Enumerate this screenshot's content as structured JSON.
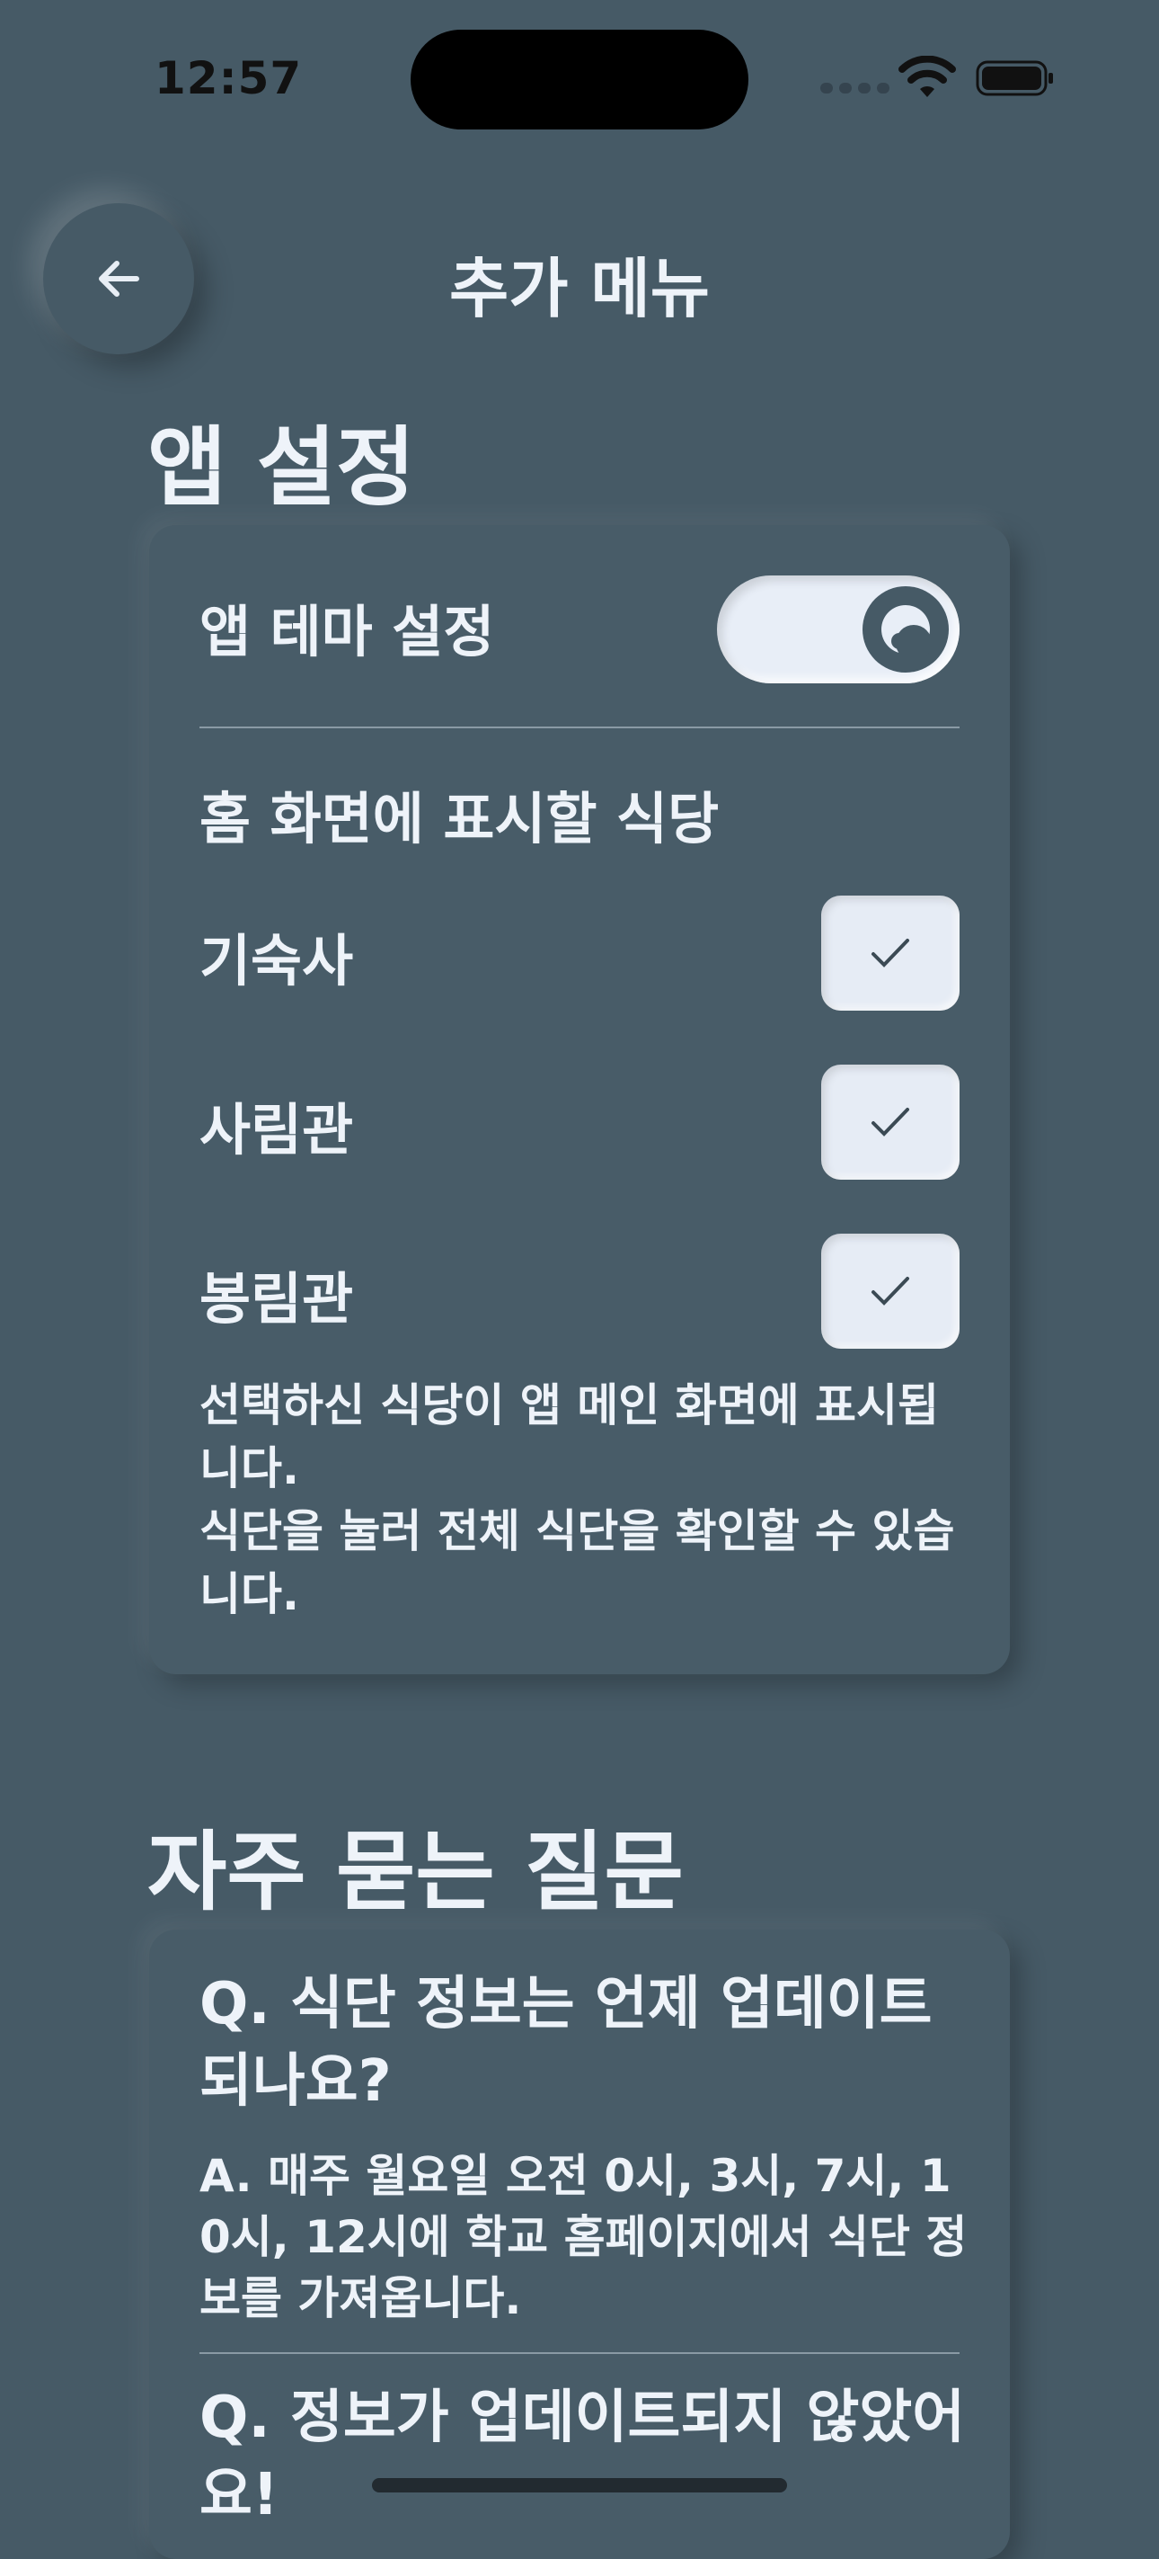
{
  "status_bar": {
    "time": "12:57"
  },
  "header": {
    "title": "추가 메뉴",
    "back_icon": "arrow-left-icon"
  },
  "app_settings": {
    "section_title": "앱 설정",
    "theme_label": "앱 테마 설정",
    "theme_toggle_icon": "moon-icon",
    "restaurants_heading": "홈 화면에 표시할 식당",
    "restaurants": [
      {
        "label": "기숙사",
        "checked": true
      },
      {
        "label": "사림관",
        "checked": true
      },
      {
        "label": "봉림관",
        "checked": true
      }
    ],
    "note_line1": "선택하신 식당이 앱 메인 화면에 표시됩니다.",
    "note_line2": "식단을 눌러 전체 식단을 확인할 수 있습니다."
  },
  "faq": {
    "section_title": "자주 묻는 질문",
    "items": [
      {
        "question": "Q. 식단 정보는 언제 업데이트 되나요?",
        "answer": "A. 매주 월요일 오전 0시, 3시, 7시, 10시, 12시에 학교 홈페이지에서 식단 정보를 가져옵니다."
      },
      {
        "question": "Q. 정보가 업데이트되지 않았어요!",
        "answer": ""
      }
    ]
  },
  "colors": {
    "background": "#465a66",
    "control_light": "#e6ecf5",
    "text": "#eef3f9"
  }
}
